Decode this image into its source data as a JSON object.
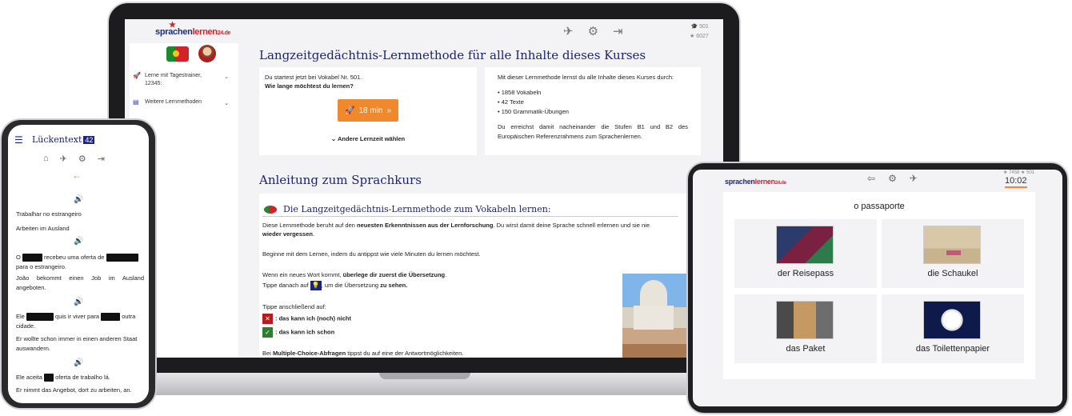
{
  "laptop": {
    "logo": {
      "main": "sprachen",
      "accent": "lernen",
      "tld": "24.de"
    },
    "icons": [
      "no-sound-icon",
      "gear-icon",
      "logout-icon"
    ],
    "stats": [
      "501",
      "6027"
    ],
    "sidebar": {
      "items": [
        {
          "label": "Lerne mit Tagestrainer, 12345:"
        },
        {
          "label": "Weitere Lernmethoden"
        }
      ]
    },
    "main_title": "Langzeitgedächtnis-Lernmethode für alle Inhalte dieses Kurses",
    "start_box": {
      "line1": "Du startest jetzt bei Vokabel Nr. 501.",
      "question": "Wie lange möchtest du lernen?",
      "button_label": "18 min",
      "other_time": "Andere Lernzeit wählen"
    },
    "info_box": {
      "intro": "Mit dieser Lernmethode lernst du alle Inhalte dieses Kurses durch:",
      "items": [
        "• 1858 Vokabeln",
        "• 42 Texte",
        "• 150 Grammatik-Übungen"
      ],
      "outro": "Du erreichst damit nacheinander die Stufen B1 und B2 des Europäischen Referenzrahmens zum Sprachenlernen."
    },
    "guide": {
      "title": "Anleitung zum Sprachkurs",
      "sub_title": "Die Langzeitgedächtnis-Lernmethode zum Vokabeln lernen:",
      "p1_a": "Diese Lernmethode beruht auf den ",
      "p1_b": "neuesten Erkenntnissen aus der Lernforschung",
      "p1_c": ". Du wirst damit deine Sprache schnell erlernen und sie nie",
      "p1_d": "wieder vergessen",
      "p1_e": ".",
      "p2": "Beginne mit dem Lernen, indem du antippst wie viele Minuten du lernen möchtest.",
      "p3_a": "Wenn ein neues Wort kommt, ",
      "p3_b": "überlege dir zuerst die Übersetzung",
      "p3_c": ".",
      "p4_a": "Tippe danach auf ",
      "p4_b": ", um die Übersetzung ",
      "p4_c": "zu sehen.",
      "p5": "Tippe anschließend auf:",
      "opt_no": ": das kann ich (noch) nicht",
      "opt_yes": ": das kann ich schon",
      "p6_a": "Bei ",
      "p6_b": "Multiple-Choice-Abfragen",
      "p6_c": " tippst du auf eine der Antwortmöglichkeiten."
    }
  },
  "phone": {
    "title": "Lückentext",
    "badge": "42",
    "lines": {
      "l1": "Trabalhar no estrangeiro",
      "l2": "Arbeiten im Ausland",
      "l3a": "O ",
      "l3b": " recebeu uma oferta de ",
      "l3c": "para o estrangeiro.",
      "l4": "João bekommt einen Job im Ausland angeboten.",
      "l5a": "Ele ",
      "l5b": " quis ir viver para ",
      "l5c": " outra",
      "l5d": "cidade.",
      "l6": "Er wollte schon immer in einen anderen Staat auswandern.",
      "l7a": "Ele aceita ",
      "l7b": " oferta de trabalho lá.",
      "l8": "Er nimmt das Angebot, dort zu arbeiten, an."
    }
  },
  "tablet": {
    "logo": {
      "main": "sprachen",
      "accent": "lernen",
      "tld": "24.de"
    },
    "stats": "★ 7458  ★ 501",
    "time": "10:02",
    "word": "o passaporte",
    "options": [
      {
        "label": "der Reisepass",
        "image": "passport-image"
      },
      {
        "label": "die Schaukel",
        "image": "swing-image"
      },
      {
        "label": "das Paket",
        "image": "parcel-image"
      },
      {
        "label": "das Toilettenpapier",
        "image": "toilet-paper-image"
      }
    ]
  },
  "colors": {
    "navy": "#1a237e",
    "orange": "#f0892b",
    "red": "#b71c1c",
    "green": "#2e7d32"
  }
}
